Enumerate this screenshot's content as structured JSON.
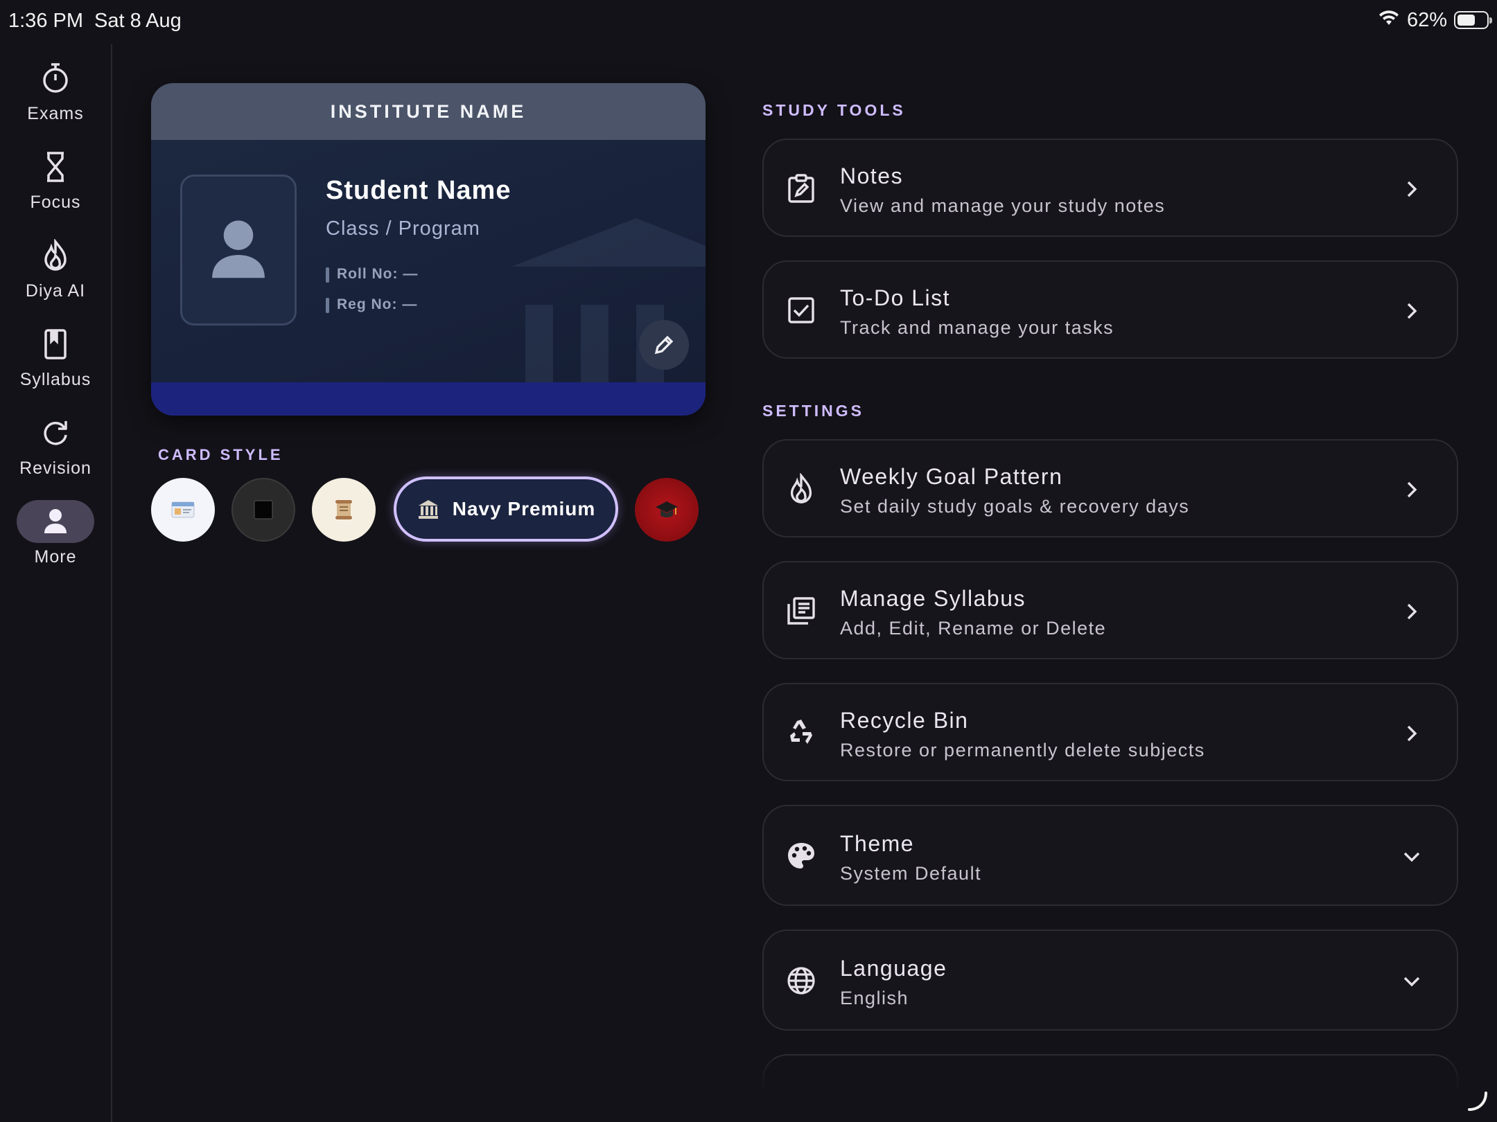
{
  "status_bar": {
    "time": "1:36 PM",
    "date": "Sat 8 Aug",
    "battery": "62%",
    "battery_level": 0.62
  },
  "nav": {
    "items": [
      {
        "label": "Exams",
        "icon": "timer-icon"
      },
      {
        "label": "Focus",
        "icon": "hourglass-icon"
      },
      {
        "label": "Diya AI",
        "icon": "flame-icon"
      },
      {
        "label": "Syllabus",
        "icon": "book-icon"
      },
      {
        "label": "Revision",
        "icon": "refresh-icon"
      },
      {
        "label": "More",
        "icon": "person-icon",
        "active": true
      }
    ]
  },
  "id_card": {
    "institute": "INSTITUTE NAME",
    "student_name": "Student Name",
    "program": "Class / Program",
    "roll_no": "Roll No: —",
    "reg_no": "Reg No: —"
  },
  "card_style": {
    "label": "CARD STYLE",
    "selected": "Navy Premium",
    "options": [
      {
        "icon": "id-card-icon",
        "color": "#f4f5fa"
      },
      {
        "icon": "black-square-icon",
        "color": "#2a2a2a"
      },
      {
        "icon": "scroll-icon",
        "color": "#f5efe2"
      },
      {
        "icon": "bank-icon",
        "name": "Navy Premium",
        "color": "#1b2440"
      },
      {
        "icon": "graduation-cap-icon",
        "color": "#8b0f10"
      }
    ]
  },
  "study_tools": {
    "label": "STUDY TOOLS",
    "items": [
      {
        "title": "Notes",
        "subtitle": "View and manage your study notes"
      },
      {
        "title": "To-Do List",
        "subtitle": "Track and manage your tasks"
      }
    ]
  },
  "settings": {
    "label": "SETTINGS",
    "items": [
      {
        "title": "Weekly Goal Pattern",
        "subtitle": "Set daily study goals & recovery days"
      },
      {
        "title": "Manage Syllabus",
        "subtitle": "Add, Edit, Rename or Delete"
      },
      {
        "title": "Recycle Bin",
        "subtitle": "Restore or permanently delete subjects"
      },
      {
        "title": "Theme",
        "subtitle": "System Default"
      },
      {
        "title": "Language",
        "subtitle": "English"
      }
    ]
  },
  "colors": {
    "background": "#131218",
    "accent": "#cfbcff",
    "card_header": "#4b5468",
    "card_footer": "#1c237d"
  }
}
